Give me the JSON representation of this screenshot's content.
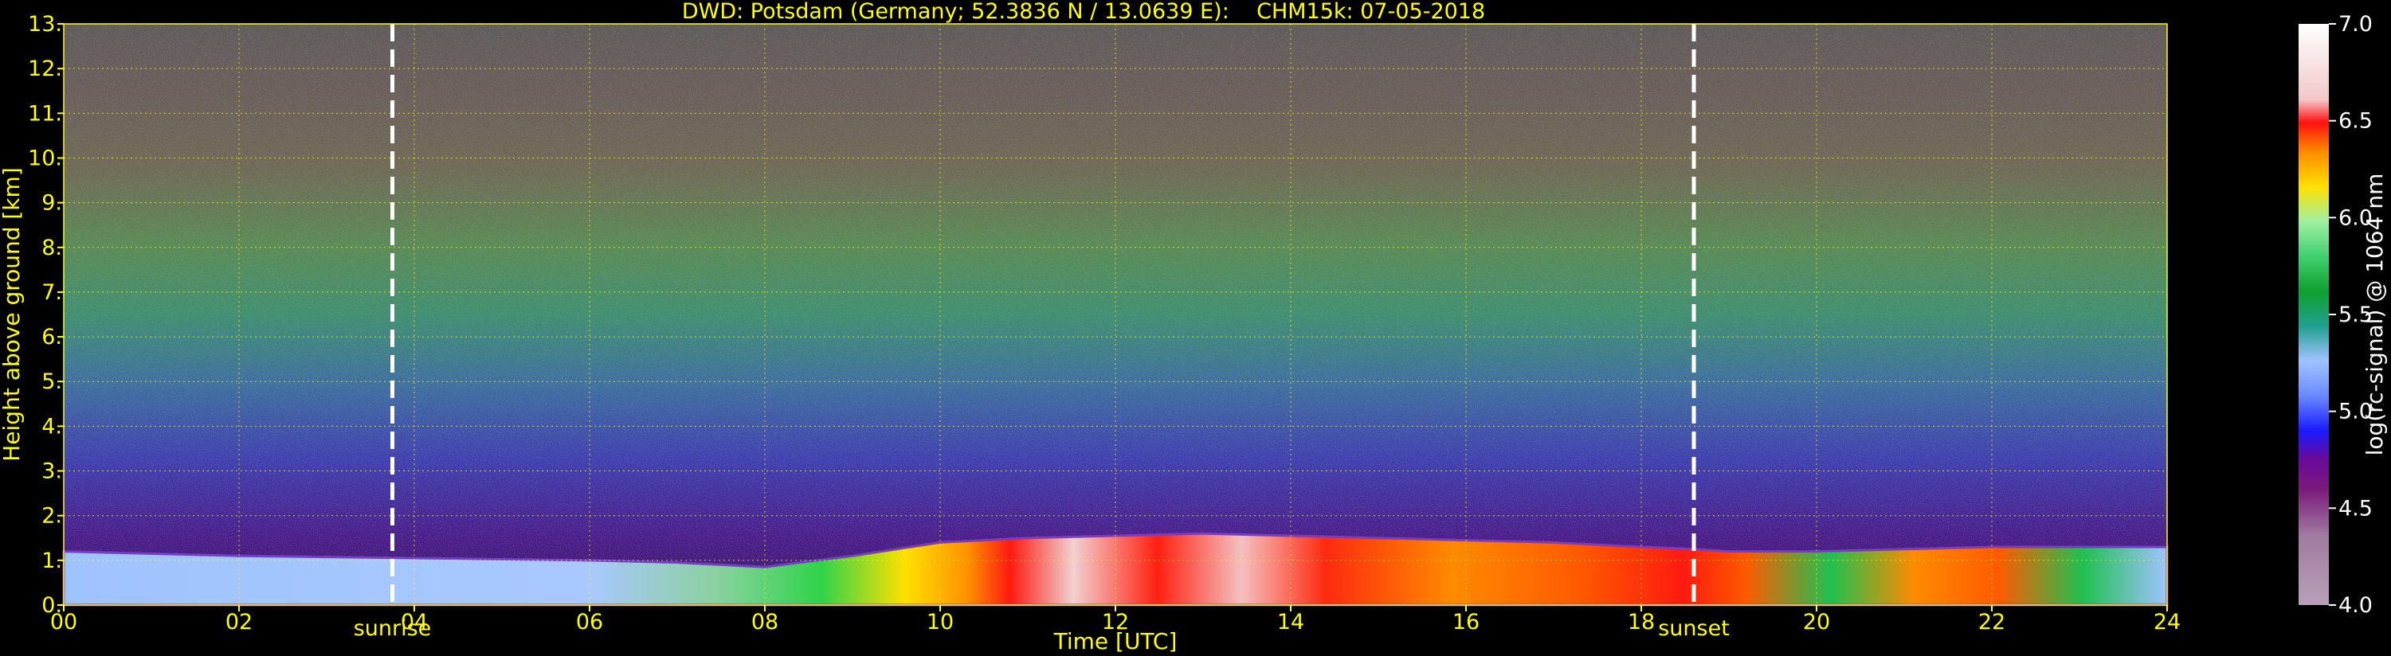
{
  "chart_data": {
    "type": "heatmap",
    "title": "DWD: Potsdam (Germany; 52.3836 N / 13.0639 E):    CHM15k: 07-05-2018",
    "xlabel": "Time [UTC]",
    "ylabel": "Height above ground [km]",
    "x_ticks": [
      "00",
      "02",
      "04",
      "06",
      "08",
      "10",
      "12",
      "14",
      "16",
      "18",
      "20",
      "22",
      "24"
    ],
    "y_ticks": [
      "0.",
      "1.",
      "2.",
      "3.",
      "4.",
      "5.",
      "6.",
      "7.",
      "8.",
      "9.",
      "10.",
      "11.",
      "12.",
      "13."
    ],
    "xlim": [
      0,
      24
    ],
    "ylim": [
      0,
      13
    ],
    "grid": true,
    "events": [
      {
        "name": "sunrise",
        "x": 3.75
      },
      {
        "name": "sunset",
        "x": 18.6
      }
    ],
    "colorbar": {
      "label": "log(rc-signal) @ 1064 nm",
      "range": [
        4.0,
        7.0
      ],
      "ticks": [
        "4.0",
        "4.5",
        "5.0",
        "5.5",
        "6.0",
        "6.5",
        "7.0"
      ]
    },
    "boundary_layer_height_km": {
      "x": [
        0,
        2,
        4,
        6,
        7,
        8,
        9,
        10,
        11,
        12,
        13,
        14,
        15,
        16,
        17,
        18,
        18.6,
        19,
        20,
        21,
        22,
        23,
        24
      ],
      "y": [
        1.2,
        1.1,
        1.05,
        1.0,
        0.95,
        0.85,
        1.1,
        1.4,
        1.5,
        1.55,
        1.6,
        1.55,
        1.5,
        1.45,
        1.4,
        1.3,
        1.25,
        1.2,
        1.2,
        1.25,
        1.3,
        1.3,
        1.3
      ]
    },
    "colors": {
      "axis": "#ffff00",
      "grid": "#ffff00",
      "event_line": "#ffffff"
    }
  }
}
